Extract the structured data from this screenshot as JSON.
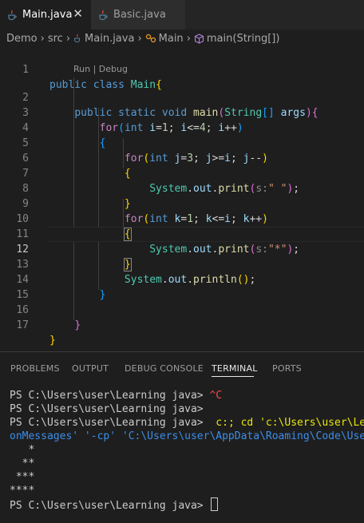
{
  "tabs": [
    {
      "label": "Main.java",
      "active": true,
      "close_glyph": "✕"
    },
    {
      "label": "Basic.java",
      "active": false
    }
  ],
  "breadcrumb": {
    "items": [
      "Demo",
      "src",
      "Main.java",
      "Main",
      "main(String[])"
    ],
    "separator": "›"
  },
  "editor": {
    "line_numbers": [
      "1",
      "2",
      "3",
      "4",
      "5",
      "6",
      "7",
      "8",
      "9",
      "10",
      "11",
      "12",
      "13",
      "14",
      "15",
      "16",
      "17"
    ],
    "current_line": "12",
    "code_lens": "Run | Debug",
    "lines": [
      "public class Main{",
      "public static void main(String[] args){",
      "for(int i=1; i<=4; i++)",
      "{",
      "for(int j=3; j>=i; j--)",
      "{",
      "System.out.print(s:\" \");",
      "}",
      "for(int k=1; k<=i; k++)",
      "{",
      "System.out.print(s:\"*\");",
      "}",
      "System.out.println();",
      "}",
      "",
      "}",
      "}"
    ],
    "param_hint": "s:"
  },
  "panel": {
    "tabs": [
      "PROBLEMS",
      "OUTPUT",
      "DEBUG CONSOLE",
      "TERMINAL",
      "PORTS"
    ],
    "active_tab": "TERMINAL"
  },
  "terminal": {
    "prompt": "PS C:\\Users\\user\\Learning java>",
    "lines": [
      {
        "prompt": "PS C:\\Users\\user\\Learning java>",
        "text": " ^C"
      },
      {
        "prompt": "PS C:\\Users\\user\\Learning java>",
        "text": ""
      },
      {
        "prompt": "PS C:\\Users\\user\\Learning java>",
        "text": "  c:; cd 'c:\\Users\\user\\Lea"
      },
      {
        "prompt": "",
        "text": "onMessages' '-cp' 'C:\\Users\\user\\AppData\\Roaming\\Code\\User"
      },
      {
        "prompt": "",
        "text": "   *"
      },
      {
        "prompt": "",
        "text": "  **"
      },
      {
        "prompt": "",
        "text": " ***"
      },
      {
        "prompt": "",
        "text": "****"
      },
      {
        "prompt": "PS C:\\Users\\user\\Learning java>",
        "text": " "
      }
    ]
  },
  "icons": {
    "java_file": "java-coffee-icon",
    "close": "close-icon",
    "symbol_class": "class-symbol-icon",
    "symbol_method": "method-cube-icon"
  },
  "colors": {
    "background": "#1e1e1e",
    "keyword": "#569cd6",
    "class": "#4ec9b0",
    "function": "#dcdcaa",
    "string": "#ce9178",
    "number": "#b5cea8",
    "terminal_error": "#f14c4c"
  }
}
